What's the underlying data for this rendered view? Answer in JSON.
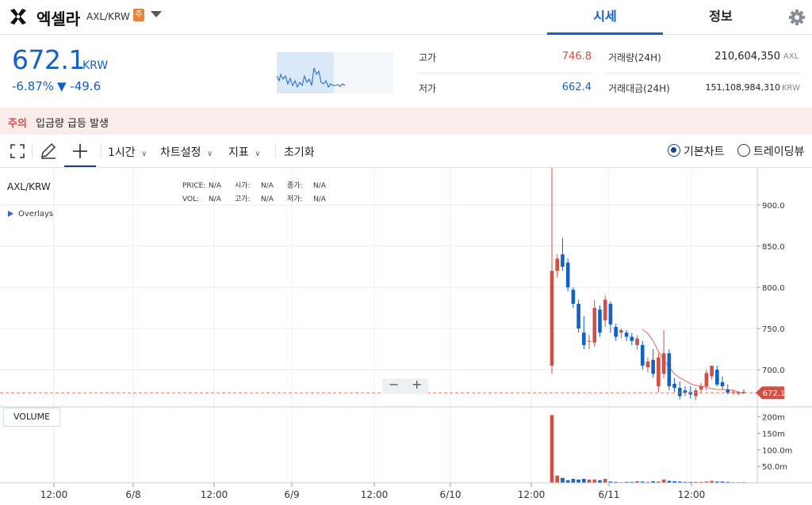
{
  "header": {
    "coin_name": "엑셀라",
    "pair": "AXL/KRW",
    "caution_badge": "주",
    "tabs": [
      {
        "label": "시세",
        "active": true
      },
      {
        "label": "정보",
        "active": false
      }
    ]
  },
  "summary": {
    "price": "672.1",
    "price_unit": "KRW",
    "change_rate": "-6.87%",
    "change_amount": "▼ -49.6",
    "high_label": "고가",
    "high_value": "746.8",
    "low_label": "저가",
    "low_value": "662.4",
    "volume_label": "거래량(24H)",
    "volume_value": "210,604,350",
    "volume_unit": "AXL",
    "trade_value_label": "거래대금(24H)",
    "trade_value_value": "151,108,984,310",
    "trade_value_unit": "KRW",
    "colors": {
      "down": "#1261c4",
      "up": "#d24f45"
    }
  },
  "warning": {
    "tag": "주의",
    "text": "입금량 급등 발생"
  },
  "toolbar": {
    "interval": "1시간",
    "chart_settings": "차트설정",
    "indicators": "지표",
    "reset": "초기화",
    "chart_modes": [
      {
        "label": "기본차트",
        "selected": true
      },
      {
        "label": "트레이딩뷰",
        "selected": false
      }
    ]
  },
  "chart": {
    "symbol": "AXL/KRW",
    "overlays_label": "Overlays",
    "legend": {
      "price_label": "PRICE:",
      "price_value": "N/A",
      "open_label": "시가:",
      "open_value": "N/A",
      "close_label": "종가:",
      "close_value": "N/A",
      "vol_label": "VOL:",
      "vol_value": "N/A",
      "high_label": "고가:",
      "high_value": "N/A",
      "low_label": "저가:",
      "low_value": "N/A"
    },
    "volume_label": "VOLUME",
    "zoom_out": "−",
    "zoom_in": "+"
  },
  "chart_data": {
    "type": "candlestick",
    "y_ticks": [
      "900.0",
      "850.0",
      "800.0",
      "750.0",
      "700.0"
    ],
    "y_tick_values": [
      900,
      850,
      800,
      750,
      700
    ],
    "current_price_label": "672.1",
    "current_price": 672.1,
    "volume_ticks": [
      "200m",
      "150m",
      "100.0m",
      "50.0m"
    ],
    "volume_tick_values": [
      200,
      150,
      100,
      50
    ],
    "x_ticks": [
      "12:00",
      "6/8",
      "12:00",
      "6/9",
      "12:00",
      "6/10",
      "12:00",
      "6/11",
      "12:00"
    ],
    "candles": [
      {
        "o": 705,
        "h": 945,
        "l": 695,
        "c": 820,
        "v": 205
      },
      {
        "o": 820,
        "h": 840,
        "l": 812,
        "c": 835,
        "v": 22
      },
      {
        "o": 840,
        "h": 860,
        "l": 820,
        "c": 825,
        "v": 15
      },
      {
        "o": 830,
        "h": 835,
        "l": 795,
        "c": 800,
        "v": 8
      },
      {
        "o": 797,
        "h": 800,
        "l": 775,
        "c": 780,
        "v": 12
      },
      {
        "o": 780,
        "h": 785,
        "l": 745,
        "c": 750,
        "v": 10
      },
      {
        "o": 745,
        "h": 765,
        "l": 725,
        "c": 730,
        "v": 12
      },
      {
        "o": 735,
        "h": 742,
        "l": 725,
        "c": 735,
        "v": 10
      },
      {
        "o": 733,
        "h": 785,
        "l": 728,
        "c": 775,
        "v": 10
      },
      {
        "o": 773,
        "h": 778,
        "l": 740,
        "c": 745,
        "v": 8
      },
      {
        "o": 760,
        "h": 790,
        "l": 752,
        "c": 785,
        "v": 12
      },
      {
        "o": 780,
        "h": 783,
        "l": 745,
        "c": 755,
        "v": 4
      },
      {
        "o": 752,
        "h": 756,
        "l": 735,
        "c": 740,
        "v": 3
      },
      {
        "o": 745,
        "h": 750,
        "l": 738,
        "c": 748,
        "v": 2
      },
      {
        "o": 745,
        "h": 748,
        "l": 735,
        "c": 740,
        "v": 3
      },
      {
        "o": 740,
        "h": 745,
        "l": 730,
        "c": 735,
        "v": 3
      },
      {
        "o": 730,
        "h": 742,
        "l": 725,
        "c": 738,
        "v": 5
      },
      {
        "o": 730,
        "h": 735,
        "l": 700,
        "c": 705,
        "v": 4
      },
      {
        "o": 703,
        "h": 715,
        "l": 697,
        "c": 710,
        "v": 3
      },
      {
        "o": 712,
        "h": 725,
        "l": 690,
        "c": 695,
        "v": 5
      },
      {
        "o": 680,
        "h": 720,
        "l": 673,
        "c": 715,
        "v": 4
      },
      {
        "o": 695,
        "h": 748,
        "l": 690,
        "c": 720,
        "v": 10
      },
      {
        "o": 720,
        "h": 725,
        "l": 675,
        "c": 680,
        "v": 6
      },
      {
        "o": 683,
        "h": 690,
        "l": 673,
        "c": 678,
        "v": 5
      },
      {
        "o": 678,
        "h": 686,
        "l": 664,
        "c": 668,
        "v": 4
      },
      {
        "o": 675,
        "h": 680,
        "l": 668,
        "c": 672,
        "v": 3
      },
      {
        "o": 673,
        "h": 680,
        "l": 665,
        "c": 670,
        "v": 3
      },
      {
        "o": 668,
        "h": 678,
        "l": 663,
        "c": 675,
        "v": 3
      },
      {
        "o": 676,
        "h": 684,
        "l": 672,
        "c": 680,
        "v": 3
      },
      {
        "o": 680,
        "h": 700,
        "l": 675,
        "c": 696,
        "v": 4
      },
      {
        "o": 692,
        "h": 705,
        "l": 688,
        "c": 705,
        "v": 6
      },
      {
        "o": 700,
        "h": 705,
        "l": 680,
        "c": 682,
        "v": 4
      },
      {
        "o": 685,
        "h": 692,
        "l": 676,
        "c": 680,
        "v": 4
      },
      {
        "o": 676,
        "h": 682,
        "l": 670,
        "c": 672,
        "v": 3
      },
      {
        "o": 673,
        "h": 676,
        "l": 670,
        "c": 673,
        "v": 2
      },
      {
        "o": 671,
        "h": 674,
        "l": 669,
        "c": 673,
        "v": 2
      },
      {
        "o": 673,
        "h": 676,
        "l": 671,
        "c": 672.1,
        "v": 2
      }
    ],
    "moving_average": [
      749,
      744,
      735,
      722,
      712,
      703,
      695,
      690,
      687,
      683,
      681,
      680,
      679,
      677,
      676,
      676,
      676,
      675,
      673,
      671
    ]
  }
}
